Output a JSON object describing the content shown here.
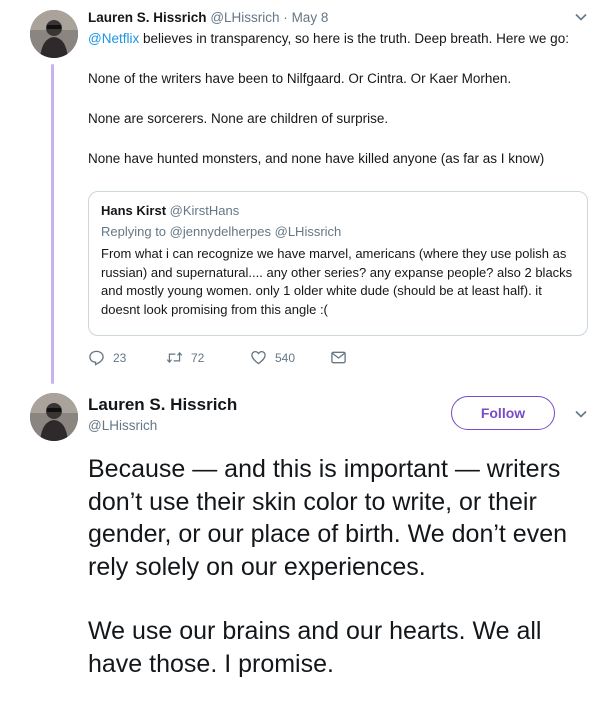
{
  "tweet1": {
    "name": "Lauren S. Hissrich",
    "handle": "@LHissrich",
    "date": "May 8",
    "mention": "@Netflix",
    "line1_rest": " believes in transparency, so here is the truth. Deep breath. Here we go:",
    "paragraphs": [
      "None of the writers have been to Nilfgaard. Or Cintra. Or Kaer Morhen.",
      "None are sorcerers. None are children of surprise.",
      "None have hunted monsters, and none have killed anyone (as far as I know)"
    ],
    "quoted": {
      "name": "Hans Kirst",
      "handle": "@KirstHans",
      "replying_to": "Replying to @jennydelherpes @LHissrich",
      "body": "From what i can recognize we have marvel, americans (where they use polish as russian) and supernatural.... any other series? any expanse people? also 2 blacks and mostly young women. only 1 older white dude (should be at least half). it doesnt look promising from this angle :("
    },
    "actions": {
      "replies": "23",
      "retweets": "72",
      "likes": "540"
    }
  },
  "tweet2": {
    "name": "Lauren S. Hissrich",
    "handle": "@LHissrich",
    "follow_label": "Follow",
    "paragraphs": [
      "Because — and this is important — writers don’t use their skin color to write, or their gender, or our place of birth. We don’t even rely solely on our experiences.",
      "We use our brains and our hearts. We all have those. I promise."
    ]
  },
  "icons": [
    "avatar",
    "chevron-down-icon",
    "reply-icon",
    "retweet-icon",
    "like-icon",
    "direct-message-icon"
  ],
  "colors": {
    "accent": "#794bc4",
    "link": "#1b95e0",
    "thread_line": "#c4b5f0",
    "secondary_text": "#657786"
  }
}
